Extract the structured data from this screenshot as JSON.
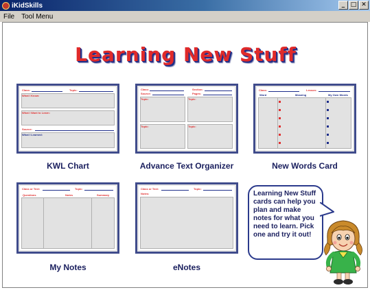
{
  "window": {
    "title": "iKidSkills",
    "min_glyph": "_",
    "max_glyph": "□",
    "close_glyph": "✕"
  },
  "menu": {
    "items": [
      "File",
      "Tool Menu"
    ]
  },
  "main": {
    "title": "Learning New Stuff"
  },
  "cards": [
    {
      "label": "KWL Chart",
      "fields": {
        "class": "Class:",
        "topic": "Topic:",
        "what_i_know": "What I Know:",
        "what_i_want": "What I Want to Learn:",
        "source": "Source:",
        "what_i_learned": "What I Learned:"
      }
    },
    {
      "label": "Advance Text Organizer",
      "fields": {
        "class": "Class:",
        "source": "Source:",
        "section": "Section:",
        "pages": "Pages:",
        "topic": "Topic:"
      }
    },
    {
      "label": "New Words Card",
      "fields": {
        "class": "Class:",
        "lesson": "Lesson:",
        "word": "Word",
        "meaning": "Meaning",
        "my_own_words": "My Own Words"
      }
    },
    {
      "label": "My Notes",
      "fields": {
        "class_or_text": "Class or Text:",
        "topic": "Topic:",
        "questions": "Questions",
        "notes": "Notes",
        "summary": "Summary"
      }
    },
    {
      "label": "eNotes",
      "fields": {
        "class_or_text": "Class or Text:",
        "topic": "Topic:",
        "notes": "Notes:"
      }
    }
  ],
  "bubble": {
    "text": "Learning New Stuff cards can help you plan and make notes for what you need to learn. Pick one and try it out!"
  },
  "colors": {
    "title_red": "#e02a2a",
    "navy": "#1a1f5e",
    "card_border": "#404c8c"
  }
}
